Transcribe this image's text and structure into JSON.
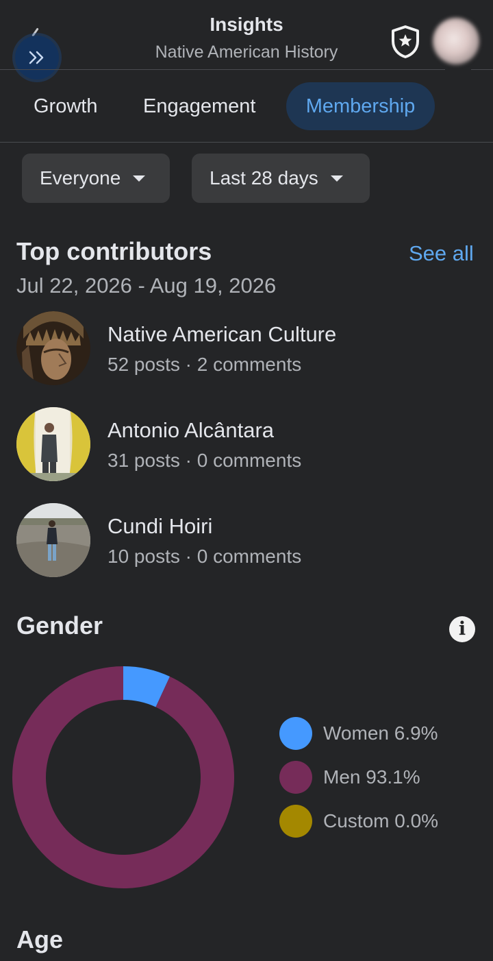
{
  "header": {
    "title": "Insights",
    "subtitle": "Native American History"
  },
  "tabs": [
    {
      "label": "Growth",
      "active": false
    },
    {
      "label": "Engagement",
      "active": false
    },
    {
      "label": "Membership",
      "active": true
    }
  ],
  "filters": {
    "audience": "Everyone",
    "period": "Last 28 days"
  },
  "top_contributors": {
    "title": "Top contributors",
    "see_all": "See all",
    "date_range": "Jul 22, 2026 - Aug 19, 2026",
    "items": [
      {
        "name": "Native American Culture",
        "stats": "52 posts · 2 comments"
      },
      {
        "name": "Antonio Alcântara",
        "stats": "31 posts · 0 comments"
      },
      {
        "name": "Cundi Hoiri",
        "stats": "10 posts · 0 comments"
      }
    ]
  },
  "gender": {
    "title": "Gender",
    "legend": [
      {
        "label": "Women 6.9%",
        "color": "#4599ff"
      },
      {
        "label": "Men 93.1%",
        "color": "#762c59"
      },
      {
        "label": "Custom 0.0%",
        "color": "#a48800"
      }
    ]
  },
  "chart_data": {
    "type": "pie",
    "categories": [
      "Women",
      "Men",
      "Custom"
    ],
    "values": [
      6.9,
      93.1,
      0.0
    ],
    "colors": [
      "#4599ff",
      "#762c59",
      "#a48800"
    ]
  },
  "age": {
    "title": "Age"
  },
  "colors": {
    "background": "#242527",
    "accent": "#5fa8ef",
    "active_tab_bg": "#1e3653"
  }
}
